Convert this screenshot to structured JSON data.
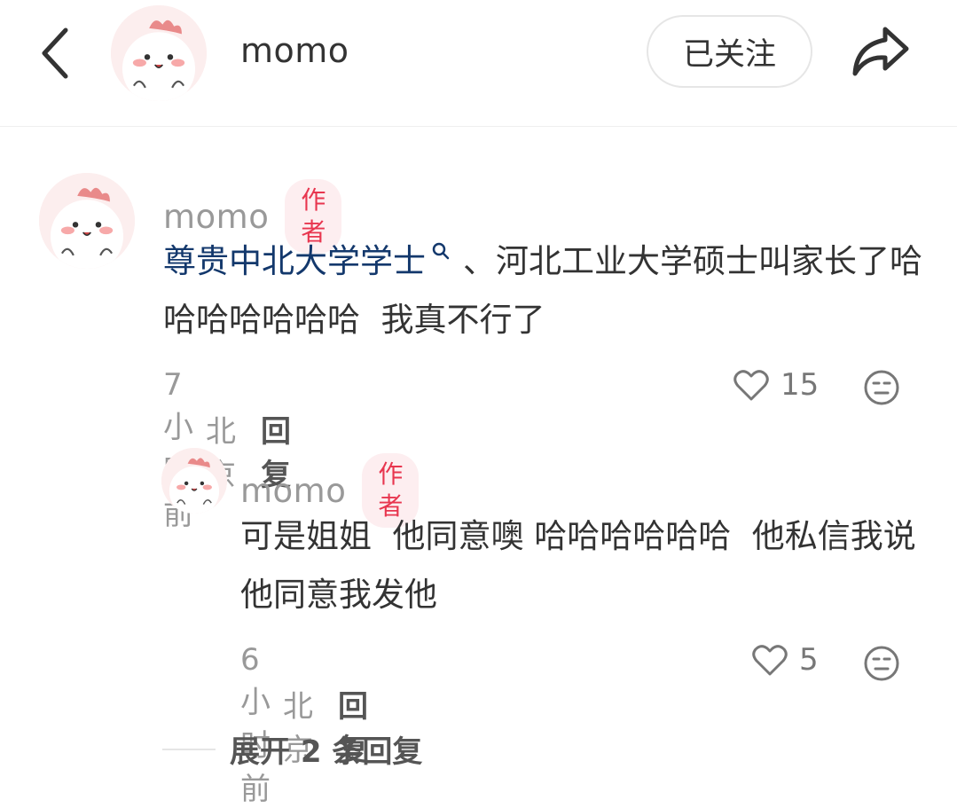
{
  "header": {
    "username": "momo",
    "follow_label": "已关注"
  },
  "comments": [
    {
      "username": "momo",
      "badge": "作者",
      "link_text": "尊贵中北大学学士",
      "text_after_link": "、河北工业大学硕士叫家长了哈哈哈哈哈哈哈  我真不行了",
      "time": "7小时前",
      "location": "北京",
      "reply_label": "回复",
      "likes": "15"
    },
    {
      "username": "momo",
      "badge": "作者",
      "text": "可是姐姐  他同意噢 哈哈哈哈哈哈  他私信我说他同意我发他",
      "time": "6小时前",
      "location": "北京",
      "reply_label": "回复",
      "likes": "5"
    }
  ],
  "expand_label": "展开 2 条回复",
  "icons": {
    "back": "chevron-left-icon",
    "share": "share-arrow-icon",
    "like": "heart-outline-icon",
    "dislike": "neutral-face-icon",
    "search": "search-icon"
  },
  "colors": {
    "badge_bg": "#fdeef0",
    "badge_text": "#e8364f",
    "link": "#13386c",
    "avatar_bg": "#fceeee"
  }
}
